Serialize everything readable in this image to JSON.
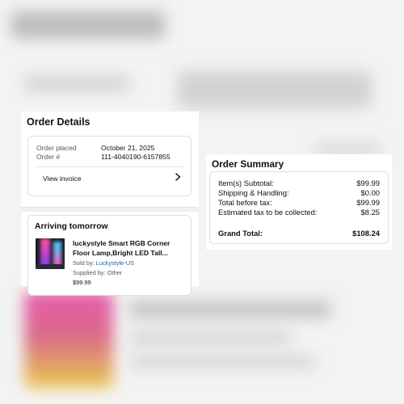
{
  "order_details": {
    "title": "Order Details",
    "order_placed_label": "Order placed",
    "order_placed_value": "October 21, 2025",
    "order_number_label": "Order #",
    "order_number_value": "111-4040190-6157855",
    "view_invoice": "View invoice",
    "chevron_icon": "chevron-right-icon"
  },
  "arriving": {
    "title": "Arriving tomorrow",
    "product_title": "luckystyle Smart RGB Corner Floor Lamp,Bright LED Tall...",
    "sold_by_label": "Sold by: ",
    "sold_by_value": "Luckystyle-US",
    "supplied_by": "Supplied by: Other",
    "price": "$99.99"
  },
  "order_summary": {
    "title": "Order Summary",
    "rows": [
      {
        "label": "Item(s) Subtotal:",
        "value": "$99.99"
      },
      {
        "label": "Shipping & Handling:",
        "value": "$0.00"
      },
      {
        "label": "Total before tax:",
        "value": "$99.99"
      },
      {
        "label": "Estimated tax to be collected:",
        "value": "$8.25"
      },
      {
        "label": "Grand Total:",
        "value": "$108.24"
      }
    ]
  },
  "colors": {
    "link": "#2162a1",
    "secondary_text": "#565959",
    "primary_text": "#0f1111"
  }
}
